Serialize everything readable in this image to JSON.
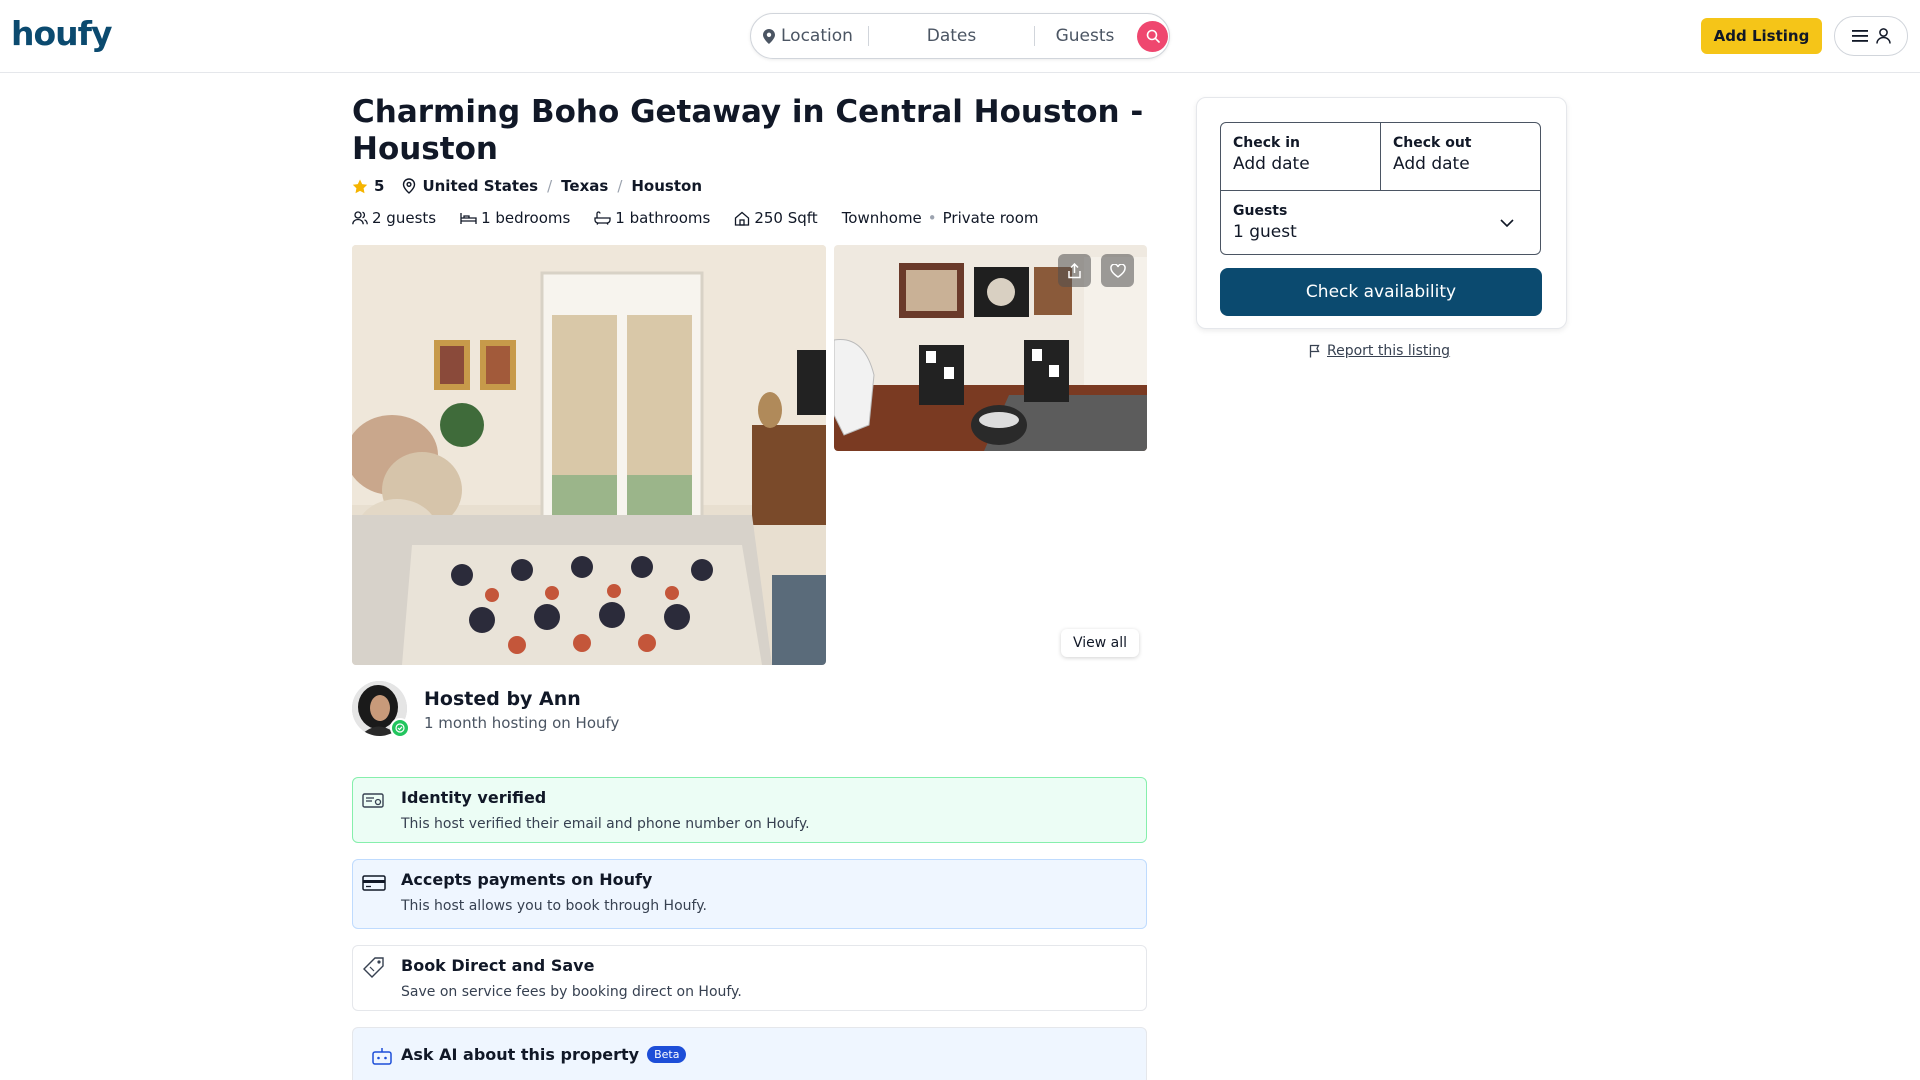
{
  "header": {
    "logo": "houfy",
    "search": {
      "location": "Location",
      "dates": "Dates",
      "guests": "Guests"
    },
    "add_listing": "Add Listing"
  },
  "listing": {
    "title": "Charming Boho Getaway in Central Houston - Houston",
    "rating": "5",
    "country": "United States",
    "state": "Texas",
    "city": "Houston",
    "facts": {
      "guests": "2 guests",
      "bedrooms": "1 bedrooms",
      "bathrooms": "1 bathrooms",
      "area": "250 Sqft",
      "property_type": "Townhome",
      "room_type": "Private room"
    },
    "view_all": "View all"
  },
  "host": {
    "name": "Hosted by Ann",
    "tenure": "1 month hosting on Houfy"
  },
  "features": [
    {
      "title": "Identity verified",
      "subtitle": "This host verified their email and phone number on Houfy."
    },
    {
      "title": "Accepts payments on Houfy",
      "subtitle": "This host allows you to book through Houfy."
    },
    {
      "title": "Book Direct and Save",
      "subtitle": "Save on service fees by booking direct on Houfy."
    },
    {
      "title": "Ask AI about this property",
      "badge": "Beta"
    }
  ],
  "booking": {
    "check_in_label": "Check in",
    "check_in_value": "Add date",
    "check_out_label": "Check out",
    "check_out_value": "Add date",
    "guests_label": "Guests",
    "guests_value": "1 guest",
    "button": "Check availability",
    "report": "Report this listing"
  },
  "colors": {
    "brand": "#0b4a6f",
    "accent_yellow": "#f5c518",
    "search_button": "#ef476f",
    "verified_bg": "#ecfdf5",
    "info_bg": "#eff6ff"
  }
}
